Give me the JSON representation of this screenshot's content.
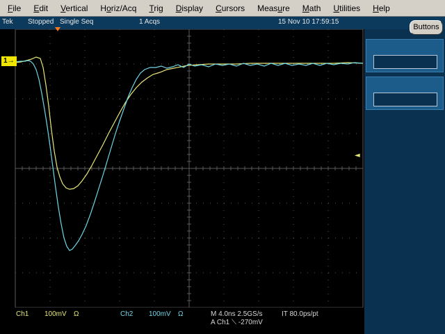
{
  "menu": [
    {
      "pre": "",
      "acc": "F",
      "post": "ile"
    },
    {
      "pre": "",
      "acc": "E",
      "post": "dit"
    },
    {
      "pre": "",
      "acc": "V",
      "post": "ertical"
    },
    {
      "pre": "H",
      "acc": "o",
      "post": "riz/Acq"
    },
    {
      "pre": "",
      "acc": "T",
      "post": "rig"
    },
    {
      "pre": "",
      "acc": "D",
      "post": "isplay"
    },
    {
      "pre": "",
      "acc": "C",
      "post": "ursors"
    },
    {
      "pre": "Meas",
      "acc": "u",
      "post": "re"
    },
    {
      "pre": "",
      "acc": "M",
      "post": "ath"
    },
    {
      "pre": "",
      "acc": "U",
      "post": "tilities"
    },
    {
      "pre": "",
      "acc": "H",
      "post": "elp"
    }
  ],
  "status": {
    "brand": "Tek",
    "state": "Stopped",
    "mode": "Single Seq",
    "acqs": "1 Acqs",
    "datetime": "15 Nov 10 17:59:15"
  },
  "buttons_label": "Buttons",
  "ch1_marker": "1",
  "readouts": {
    "ch1_label": "Ch1",
    "ch1_scale": "100mV",
    "ch1_ohm": "Ω",
    "ch2_label": "Ch2",
    "ch2_scale": "100mV",
    "ch2_ohm": "Ω",
    "horiz": "M 4.0ns 2.5GS/s",
    "it": "IT 80.0ps/pt",
    "trigger": "A  Ch1  ⟍  -270mV"
  },
  "colors": {
    "ch1": "#e8e878",
    "ch2": "#6fd6e6",
    "graticule": "#5a5a5a"
  }
}
